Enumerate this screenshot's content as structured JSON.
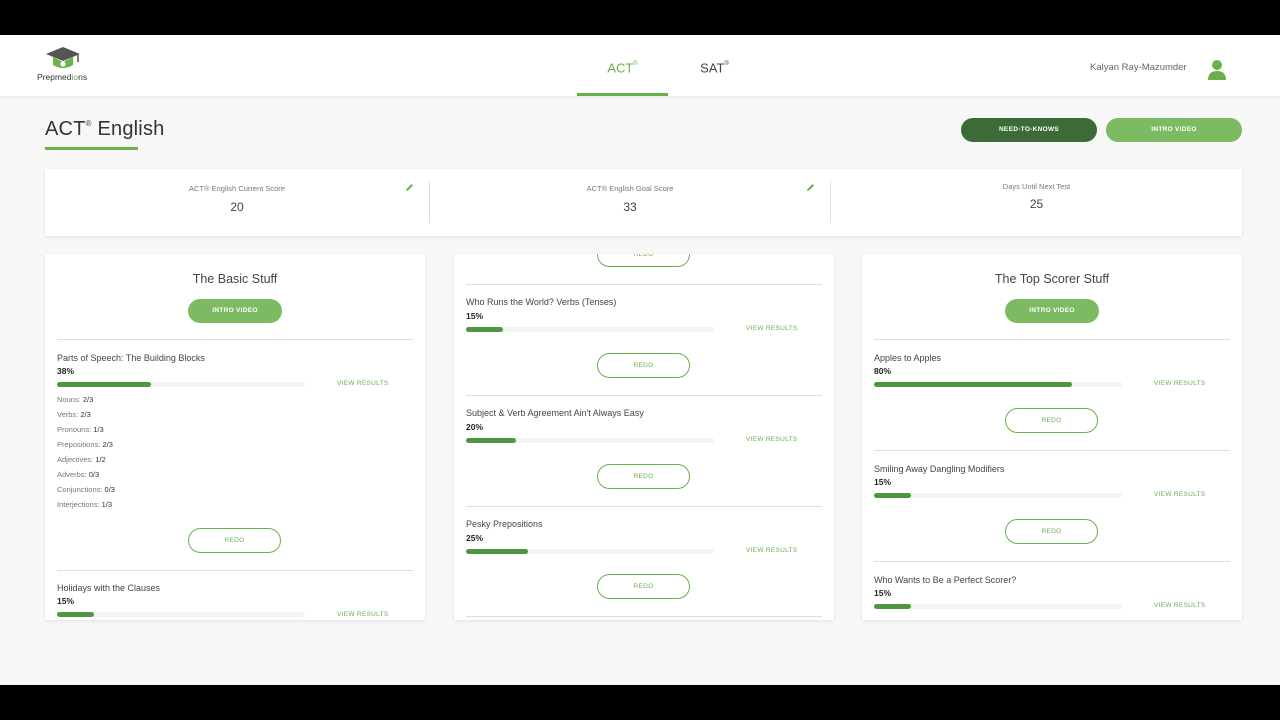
{
  "brand": {
    "logo_prefix": "Prepmed",
    "logo_suffix": "i",
    "logo_end": "ns"
  },
  "nav": {
    "tabs": [
      {
        "label": "ACT",
        "mark": "®",
        "active": true
      },
      {
        "label": "SAT",
        "mark": "®",
        "active": false
      }
    ],
    "user_name": "Kalyan Ray-Mazumder"
  },
  "page": {
    "title": "ACT",
    "title_mark": "®",
    "title_rest": " English",
    "need_to_knows_label": "NEED-TO-KNOWS",
    "intro_video_label": "INTRO VIDEO"
  },
  "scores": {
    "current_label": "ACT® English Current Score",
    "current_value": "20",
    "goal_label": "ACT® English Goal Score",
    "goal_value": "33",
    "days_label": "Days Until Next Test",
    "days_value": "25"
  },
  "columns": [
    {
      "title": "The Basic Stuff",
      "intro_label": "INTRO VIDEO",
      "topics": [
        {
          "title": "Parts of Speech: The Building Blocks",
          "percent": "38%",
          "progress": 0.38,
          "view_results": "VIEW RESULTS",
          "breakdown": [
            {
              "label": "Nouns:",
              "value": "2/3"
            },
            {
              "label": "Verbs:",
              "value": "2/3"
            },
            {
              "label": "Pronouns:",
              "value": "1/3"
            },
            {
              "label": "Prepositions:",
              "value": "2/3"
            },
            {
              "label": "Adjectives:",
              "value": "1/2"
            },
            {
              "label": "Adverbs:",
              "value": "0/3"
            },
            {
              "label": "Conjunctions:",
              "value": "0/3"
            },
            {
              "label": "Interjections:",
              "value": "1/3"
            }
          ],
          "redo": "REDO"
        },
        {
          "title": "Holidays with the Clauses",
          "percent": "15%",
          "progress": 0.15,
          "view_results": "VIEW RESULTS"
        }
      ]
    },
    {
      "top_redo": "REDO",
      "topics": [
        {
          "title": "Who Runs the World? Verbs (Tenses)",
          "percent": "15%",
          "progress": 0.15,
          "view_results": "VIEW RESULTS",
          "redo": "REDO"
        },
        {
          "title": "Subject & Verb Agreement Ain't Always Easy",
          "percent": "20%",
          "progress": 0.2,
          "view_results": "VIEW RESULTS",
          "redo": "REDO"
        },
        {
          "title": "Pesky Prepositions",
          "percent": "25%",
          "progress": 0.25,
          "view_results": "VIEW RESULTS",
          "redo": "REDO"
        }
      ]
    },
    {
      "title": "The Top Scorer Stuff",
      "intro_label": "INTRO VIDEO",
      "topics": [
        {
          "title": "Apples to Apples",
          "percent": "80%",
          "progress": 0.8,
          "view_results": "VIEW RESULTS",
          "redo": "REDO"
        },
        {
          "title": "Smiling Away Dangling Modifiers",
          "percent": "15%",
          "progress": 0.15,
          "view_results": "VIEW RESULTS",
          "redo": "REDO"
        },
        {
          "title": "Who Wants to Be a Perfect Scorer?",
          "percent": "15%",
          "progress": 0.15,
          "view_results": "VIEW RESULTS"
        }
      ]
    }
  ],
  "colors": {
    "accent": "#6ab04c",
    "dark_green": "#3c6b38",
    "bar_fill": "#4e9642",
    "pill_green": "#7dbb63"
  }
}
